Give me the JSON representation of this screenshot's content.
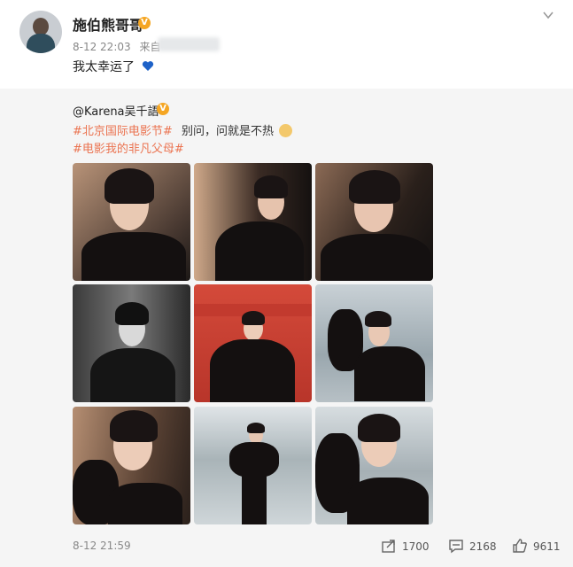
{
  "post": {
    "username": "施伯熊哥哥",
    "timestamp": "8-12 22:03",
    "source_prefix": "来自",
    "text": "我太幸运了",
    "heart_color": "#1e62c8"
  },
  "repost": {
    "author": "@Karena吴千語",
    "tag1": "#北京国际电影节#",
    "text1": "别问，问就是不热",
    "tag2": "#电影我的非凡父母#",
    "tag_color": "#eb7350",
    "timestamp": "8-12 21:59"
  },
  "photos": [
    {
      "name": "photo-1",
      "style": "warm"
    },
    {
      "name": "photo-2",
      "style": "warm"
    },
    {
      "name": "photo-3",
      "style": "warm"
    },
    {
      "name": "photo-4",
      "style": "mono"
    },
    {
      "name": "photo-5",
      "style": "red"
    },
    {
      "name": "photo-6",
      "style": "lake"
    },
    {
      "name": "photo-7",
      "style": "warm"
    },
    {
      "name": "photo-8",
      "style": "lake"
    },
    {
      "name": "photo-9",
      "style": "lake"
    }
  ],
  "actions": {
    "share_count": "1700",
    "comment_count": "2168",
    "like_count": "9611"
  }
}
